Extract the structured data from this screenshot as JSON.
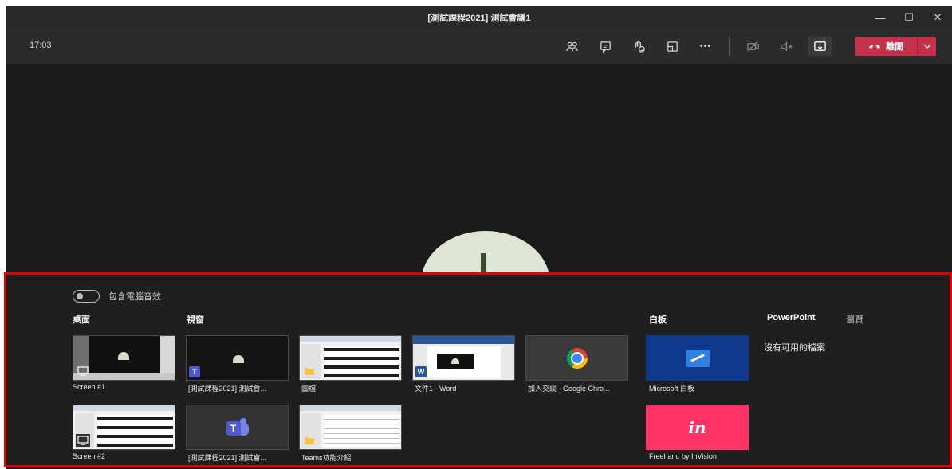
{
  "window": {
    "title": "[測試課程2021] 測試會議1",
    "minimize_glyph": "—",
    "maximize_glyph": "☐",
    "close_glyph": "✕"
  },
  "toolbar": {
    "clock": "17:03",
    "more_glyph": "•••",
    "leave_label": "離開"
  },
  "share": {
    "include_audio_label": "包含電腦音效",
    "sections": {
      "desktop": "桌面",
      "window": "視窗",
      "whiteboard": "白板",
      "powerpoint": "PowerPoint",
      "browse": "瀏覽"
    },
    "no_files": "沒有可用的檔案",
    "desktop_items": [
      "Screen #1",
      "Screen #2"
    ],
    "window_items": [
      "[測試課程2021] 測試會...",
      "圖檔",
      "文件1 - Word",
      "加入交談 - Google Chro...",
      "[測試課程2021] 測試會...",
      "Teams功能介紹"
    ],
    "whiteboard_items": [
      "Microsoft 白板",
      "Freehand by InVision"
    ],
    "word_badge": "W",
    "teams_badge": "T",
    "invision_mark": "in"
  },
  "colors": {
    "leave_red": "#c4314b",
    "highlight_red": "#e80000",
    "teams_purple": "#5059c9",
    "whiteboard_blue": "#0f3a8c",
    "invision_pink": "#ff3366"
  }
}
